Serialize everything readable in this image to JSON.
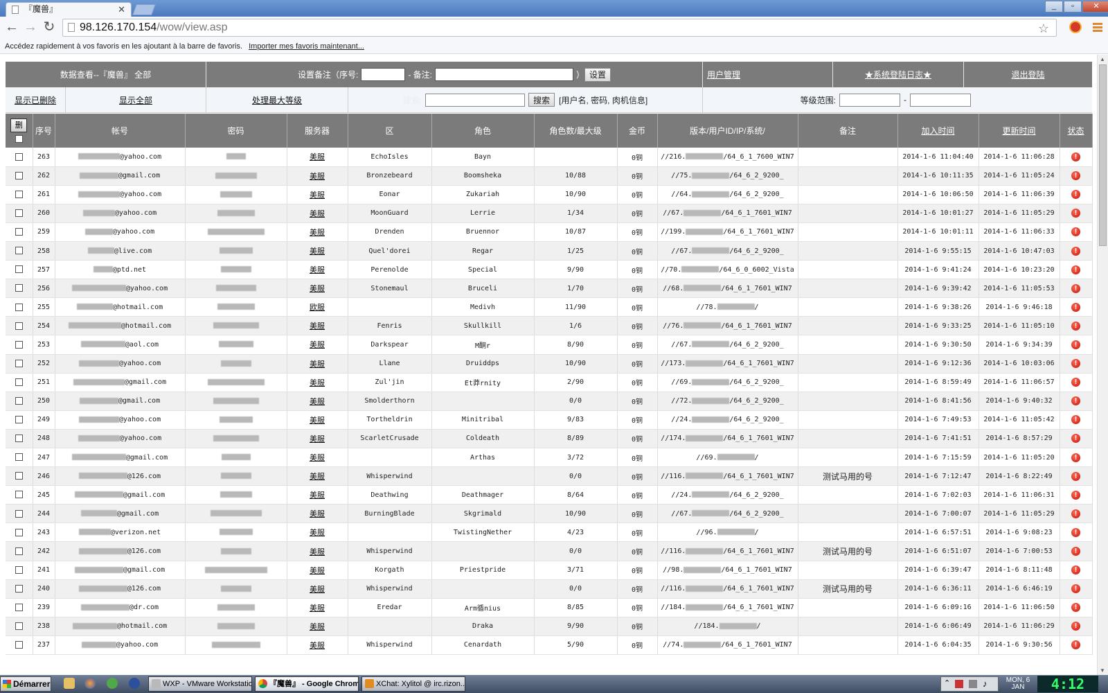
{
  "browser": {
    "tab_title": "『魔兽』",
    "url_host": "98.126.170.154",
    "url_path": "/wow/view.asp",
    "bookmark_hint": "Accédez rapidement à vos favoris en les ajoutant à la barre de favoris.",
    "bookmark_import": "Importer mes favoris maintenant..."
  },
  "header": {
    "view_label": "数据查看--『魔兽』 全部",
    "note_prefix": "设置备注（序号:",
    "note_dash": "- 备注:",
    "note_close": "）",
    "set_button": "设置",
    "user_mgmt": "用户管理",
    "system_log": "★系统登陆日志★",
    "logout": "退出登陆",
    "show_deleted": "显示已删除",
    "show_all": "显示全部",
    "max_level": "处理最大等级",
    "search_label": "搜索:",
    "search_button": "搜索",
    "search_hint": "[用户名, 密码, 肉机信息]",
    "level_range": "等级范围:",
    "level_dash": "-"
  },
  "table": {
    "delete_button": "删",
    "columns": [
      "序号",
      "帐号",
      "密码",
      "服务器",
      "区",
      "角色",
      "角色数/最大级",
      "金币",
      "版本/用户ID/IP/系统/",
      "备注",
      "加入时间",
      "更新时间",
      "状态"
    ],
    "status_icon": "alert-icon",
    "rows": [
      {
        "id": "263",
        "email": "@yahoo.com",
        "ew": 60,
        "pw": 28,
        "server": "美服",
        "realm": "EchoIsles",
        "char": "Bayn",
        "level": "",
        "gold": "0铜",
        "ip_pre": "//216.",
        "ip_suf": "/64_6_1_7600_WIN7",
        "note": "",
        "join": "2014-1-6 11:04:40",
        "update": "2014-1-6 11:06:28"
      },
      {
        "id": "262",
        "email": "@gmail.com",
        "ew": 56,
        "pw": 60,
        "server": "美服",
        "realm": "Bronzebeard",
        "char": "Boomsheka",
        "level": "10/88",
        "gold": "0铜",
        "ip_pre": "//75.",
        "ip_suf": "/64_6_2_9200_",
        "note": "",
        "join": "2014-1-6 10:11:35",
        "update": "2014-1-6 11:05:24"
      },
      {
        "id": "261",
        "email": "@yahoo.com",
        "ew": 60,
        "pw": 46,
        "server": "美服",
        "realm": "Eonar",
        "char": "Zukariah",
        "level": "10/90",
        "gold": "0铜",
        "ip_pre": "//64.",
        "ip_suf": "/64_6_2_9200_",
        "note": "",
        "join": "2014-1-6 10:06:50",
        "update": "2014-1-6 11:06:39"
      },
      {
        "id": "260",
        "email": "@yahoo.com",
        "ew": 46,
        "pw": 54,
        "server": "美服",
        "realm": "MoonGuard",
        "char": "Lerrie",
        "level": "1/34",
        "gold": "0铜",
        "ip_pre": "//67.",
        "ip_suf": "/64_6_1_7601_WIN7",
        "note": "",
        "join": "2014-1-6 10:01:27",
        "update": "2014-1-6 11:05:29"
      },
      {
        "id": "259",
        "email": "@yahoo.com",
        "ew": 40,
        "pw": 82,
        "server": "美服",
        "realm": "Drenden",
        "char": "Bruennor",
        "level": "10/87",
        "gold": "0铜",
        "ip_pre": "//199.",
        "ip_suf": "/64_6_1_7601_WIN7",
        "note": "",
        "join": "2014-1-6 10:01:11",
        "update": "2014-1-6 11:06:33"
      },
      {
        "id": "258",
        "email": "@live.com",
        "ew": 38,
        "pw": 48,
        "server": "美服",
        "realm": "Quel'dorei",
        "char": "Regar",
        "level": "1/25",
        "gold": "0铜",
        "ip_pre": "//67.",
        "ip_suf": "/64_6_2_9200_",
        "note": "",
        "join": "2014-1-6 9:55:15",
        "update": "2014-1-6 10:47:03"
      },
      {
        "id": "257",
        "email": "@ptd.net",
        "ew": 28,
        "pw": 44,
        "server": "美服",
        "realm": "Perenolde",
        "char": "Special",
        "level": "9/90",
        "gold": "0铜",
        "ip_pre": "//70.",
        "ip_suf": "/64_6_0_6002_Vista",
        "note": "",
        "join": "2014-1-6 9:41:24",
        "update": "2014-1-6 10:23:20"
      },
      {
        "id": "256",
        "email": "@yahoo.com",
        "ew": 78,
        "pw": 58,
        "server": "美服",
        "realm": "Stonemaul",
        "char": "Bruceli",
        "level": "1/70",
        "gold": "0铜",
        "ip_pre": "//68.",
        "ip_suf": "/64_6_1_7601_WIN7",
        "note": "",
        "join": "2014-1-6 9:39:42",
        "update": "2014-1-6 11:05:53"
      },
      {
        "id": "255",
        "email": "@hotmail.com",
        "ew": 52,
        "pw": 54,
        "server": "欧服",
        "realm": "",
        "char": "Medivh",
        "level": "11/90",
        "gold": "0铜",
        "ip_pre": "//78.",
        "ip_suf": "/",
        "note": "",
        "join": "2014-1-6 9:38:26",
        "update": "2014-1-6 9:46:18"
      },
      {
        "id": "254",
        "email": "@hotmail.com",
        "ew": 76,
        "pw": 66,
        "server": "美服",
        "realm": "Fenris",
        "char": "Skullkill",
        "level": "1/6",
        "gold": "0铜",
        "ip_pre": "//76.",
        "ip_suf": "/64_6_1_7601_WIN7",
        "note": "",
        "join": "2014-1-6 9:33:25",
        "update": "2014-1-6 11:05:10"
      },
      {
        "id": "253",
        "email": "@aol.com",
        "ew": 64,
        "pw": 50,
        "server": "美服",
        "realm": "Darkspear",
        "char": "M酮r",
        "level": "8/90",
        "gold": "0铜",
        "ip_pre": "//67.",
        "ip_suf": "/64_6_2_9200_",
        "note": "",
        "join": "2014-1-6 9:30:50",
        "update": "2014-1-6 9:34:39"
      },
      {
        "id": "252",
        "email": "@yahoo.com",
        "ew": 58,
        "pw": 44,
        "server": "美服",
        "realm": "Llane",
        "char": "Druiddps",
        "level": "10/90",
        "gold": "0铜",
        "ip_pre": "//173.",
        "ip_suf": "/64_6_1_7601_WIN7",
        "note": "",
        "join": "2014-1-6 9:12:36",
        "update": "2014-1-6 10:03:06"
      },
      {
        "id": "251",
        "email": "@gmail.com",
        "ew": 74,
        "pw": 82,
        "server": "美服",
        "realm": "Zul'jin",
        "char": "Et莽rnity",
        "level": "2/90",
        "gold": "0铜",
        "ip_pre": "//69.",
        "ip_suf": "/64_6_2_9200_",
        "note": "",
        "join": "2014-1-6 8:59:49",
        "update": "2014-1-6 11:06:57"
      },
      {
        "id": "250",
        "email": "@gmail.com",
        "ew": 56,
        "pw": 66,
        "server": "美服",
        "realm": "Smolderthorn",
        "char": "",
        "level": "0/0",
        "gold": "0铜",
        "ip_pre": "//72.",
        "ip_suf": "/64_6_2_9200_",
        "note": "",
        "join": "2014-1-6 8:41:56",
        "update": "2014-1-6 9:40:32"
      },
      {
        "id": "249",
        "email": "@yahoo.com",
        "ew": 58,
        "pw": 48,
        "server": "美服",
        "realm": "Tortheldrin",
        "char": "Minitribal",
        "level": "9/83",
        "gold": "0铜",
        "ip_pre": "//24.",
        "ip_suf": "/64_6_2_9200_",
        "note": "",
        "join": "2014-1-6 7:49:53",
        "update": "2014-1-6 11:05:42"
      },
      {
        "id": "248",
        "email": "@yahoo.com",
        "ew": 60,
        "pw": 66,
        "server": "美服",
        "realm": "ScarletCrusade",
        "char": "Coldeath",
        "level": "8/89",
        "gold": "0铜",
        "ip_pre": "//174.",
        "ip_suf": "/64_6_1_7601_WIN7",
        "note": "",
        "join": "2014-1-6 7:41:51",
        "update": "2014-1-6 8:57:29"
      },
      {
        "id": "247",
        "email": "@gmail.com",
        "ew": 78,
        "pw": 42,
        "server": "美服",
        "realm": "",
        "char": "Arthas",
        "level": "3/72",
        "gold": "0铜",
        "ip_pre": "//69.",
        "ip_suf": "/",
        "note": "",
        "join": "2014-1-6 7:15:59",
        "update": "2014-1-6 11:05:20"
      },
      {
        "id": "246",
        "email": "@126.com",
        "ew": 70,
        "pw": 44,
        "server": "美服",
        "realm": "Whisperwind",
        "char": "",
        "level": "0/0",
        "gold": "0铜",
        "ip_pre": "//116.",
        "ip_suf": "/64_6_1_7601_WIN7",
        "note": "测试马用的号",
        "join": "2014-1-6 7:12:47",
        "update": "2014-1-6 8:22:49"
      },
      {
        "id": "245",
        "email": "@gmail.com",
        "ew": 70,
        "pw": 46,
        "server": "美服",
        "realm": "Deathwing",
        "char": "Deathmager",
        "level": "8/64",
        "gold": "0铜",
        "ip_pre": "//24.",
        "ip_suf": "/64_6_2_9200_",
        "note": "",
        "join": "2014-1-6 7:02:03",
        "update": "2014-1-6 11:06:31"
      },
      {
        "id": "244",
        "email": "@gmail.com",
        "ew": 52,
        "pw": 74,
        "server": "美服",
        "realm": "BurningBlade",
        "char": "Skgrimald",
        "level": "10/90",
        "gold": "0铜",
        "ip_pre": "//67.",
        "ip_suf": "/64_6_2_9200_",
        "note": "",
        "join": "2014-1-6 7:00:07",
        "update": "2014-1-6 11:05:29"
      },
      {
        "id": "243",
        "email": "@verizon.net",
        "ew": 46,
        "pw": 48,
        "server": "美服",
        "realm": "",
        "char": "TwistingNether",
        "level": "4/23",
        "gold": "0铜",
        "ip_pre": "//96.",
        "ip_suf": "/",
        "note": "",
        "join": "2014-1-6 6:57:51",
        "update": "2014-1-6 9:08:23"
      },
      {
        "id": "242",
        "email": "@126.com",
        "ew": 70,
        "pw": 44,
        "server": "美服",
        "realm": "Whisperwind",
        "char": "",
        "level": "0/0",
        "gold": "0铜",
        "ip_pre": "//116.",
        "ip_suf": "/64_6_1_7601_WIN7",
        "note": "测试马用的号",
        "join": "2014-1-6 6:51:07",
        "update": "2014-1-6 7:00:53"
      },
      {
        "id": "241",
        "email": "@gmail.com",
        "ew": 70,
        "pw": 90,
        "server": "美服",
        "realm": "Korgath",
        "char": "Priestpride",
        "level": "3/71",
        "gold": "0铜",
        "ip_pre": "//98.",
        "ip_suf": "/64_6_1_7601_WIN7",
        "note": "",
        "join": "2014-1-6 6:39:47",
        "update": "2014-1-6 8:11:48"
      },
      {
        "id": "240",
        "email": "@126.com",
        "ew": 70,
        "pw": 44,
        "server": "美服",
        "realm": "Whisperwind",
        "char": "",
        "level": "0/0",
        "gold": "0铜",
        "ip_pre": "//116.",
        "ip_suf": "/64_6_1_7601_WIN7",
        "note": "测试马用的号",
        "join": "2014-1-6 6:36:11",
        "update": "2014-1-6 6:46:19"
      },
      {
        "id": "239",
        "email": "@dr.com",
        "ew": 70,
        "pw": 54,
        "server": "美服",
        "realm": "Eredar",
        "char": "Arm循nius",
        "level": "8/85",
        "gold": "0铜",
        "ip_pre": "//184.",
        "ip_suf": "/64_6_1_7601_WIN7",
        "note": "",
        "join": "2014-1-6 6:09:16",
        "update": "2014-1-6 11:06:50"
      },
      {
        "id": "238",
        "email": "@hotmail.com",
        "ew": 64,
        "pw": 54,
        "server": "美服",
        "realm": "",
        "char": "Draka",
        "level": "9/90",
        "gold": "0铜",
        "ip_pre": "//184.",
        "ip_suf": "/",
        "note": "",
        "join": "2014-1-6 6:06:49",
        "update": "2014-1-6 11:06:29"
      },
      {
        "id": "237",
        "email": "@yahoo.com",
        "ew": 50,
        "pw": 70,
        "server": "美服",
        "realm": "Whisperwind",
        "char": "Cenardath",
        "level": "5/90",
        "gold": "0铜",
        "ip_pre": "//74.",
        "ip_suf": "/64_6_1_7601_WIN7",
        "note": "",
        "join": "2014-1-6 6:04:35",
        "update": "2014-1-6 9:30:56"
      }
    ]
  },
  "taskbar": {
    "start": "Démarrer",
    "tasks": [
      "WXP - VMware Workstation",
      "『魔兽』 - Google Chrome",
      "XChat: Xylitol @ irc.rizon..."
    ],
    "date_line1": "MON, 6",
    "date_line2": "JAN",
    "time": "4:12"
  },
  "colors": {
    "header_bg": "#7b7b7b",
    "row_alt": "#f0f0f0",
    "status_red": "#c7120a",
    "clock_green": "#36ff6b"
  }
}
